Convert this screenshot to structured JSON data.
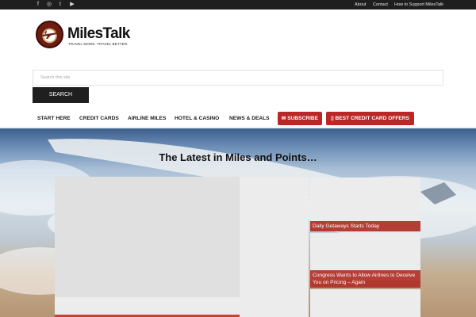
{
  "topbar": {
    "social_icons": [
      "facebook-icon",
      "instagram-icon",
      "twitter-icon",
      "youtube-icon"
    ],
    "social_glyphs": [
      "f",
      "◎",
      "t",
      "▶"
    ],
    "links": [
      "About",
      "Contact",
      "How to Support MilesTalk"
    ]
  },
  "logo": {
    "name": "MilesTalk",
    "tagline": "TRAVEL MORE. TRAVEL BETTER.",
    "badge_text": "MILES TALK"
  },
  "search": {
    "placeholder": "Search this site",
    "button_label": "SEARCH"
  },
  "nav": {
    "items": [
      "START HERE",
      "CREDIT CARDS",
      "AIRLINE MILES",
      "HOTEL & CASINO",
      "NEWS & DEALS"
    ],
    "subscribe_label": "✉ SUBSCRIBE",
    "offers_label": "▯ BEST CREDIT CARD OFFERS"
  },
  "hero": {
    "title": "The Latest in Miles and Points…",
    "side_posts": [
      "Daily Getaways Starts Today",
      "Congress Wants to Allow Airlines to Deceive You on Pricing – Again"
    ]
  },
  "colors": {
    "accent": "#b92727",
    "topbar": "#1e1e1e",
    "caption": "#b02f26"
  }
}
